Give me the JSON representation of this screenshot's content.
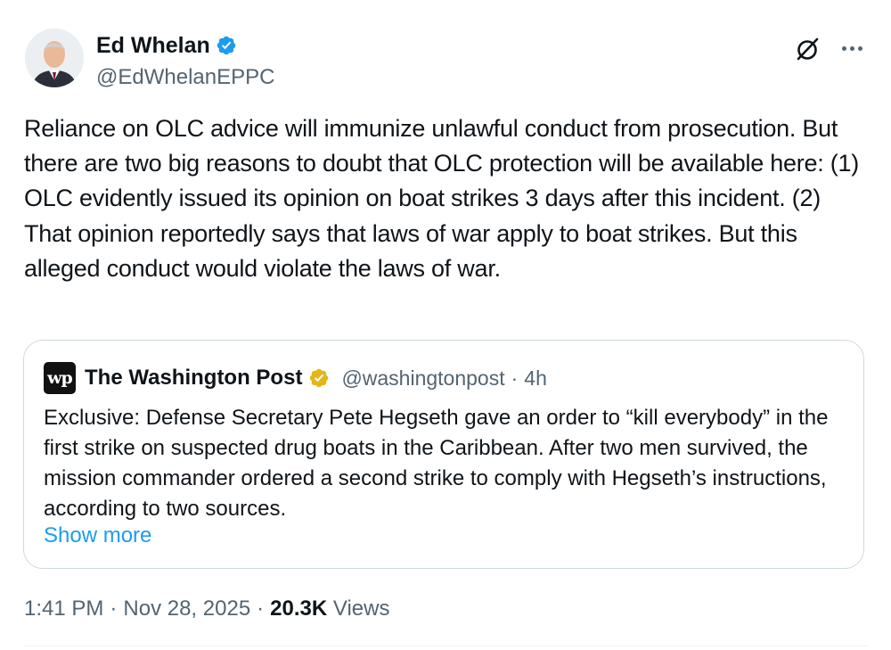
{
  "author": {
    "display_name": "Ed Whelan",
    "handle": "@EdWhelanEPPC",
    "verified_color": "#1d9bf0"
  },
  "tweet": {
    "text": "Reliance on OLC advice will immunize unlawful conduct from prosecution. But there are two big reasons to doubt that OLC protection will be available here: (1) OLC evidently issued its opinion on boat strikes 3 days after this incident. (2) That opinion reportedly says that laws of war apply to boat strikes. But this alleged conduct would violate the laws of war."
  },
  "quote": {
    "logo_text": "wp",
    "display_name": "The Washington Post",
    "handle": "@washingtonpost",
    "separator": "·",
    "time": "4h",
    "verified_color": "#e2b719",
    "text": "Exclusive: Defense Secretary Pete Hegseth gave an order to “kill everybody” in the first strike on suspected drug boats in the Caribbean. After two men survived, the mission commander ordered a second strike to comply with Hegseth’s instructions, according to two sources.",
    "show_more": "Show more"
  },
  "meta": {
    "time": "1:41 PM",
    "dot1": "·",
    "date": "Nov 28, 2025",
    "dot2": "·",
    "views_count": "20.3K",
    "views_label": "Views"
  },
  "icons": {
    "grok": "grok-icon",
    "more": "more-icon",
    "verified": "verified-badge-icon",
    "gold_verified": "gold-verified-badge-icon"
  },
  "colors": {
    "link": "#1d9bf0",
    "secondary_text": "#536471",
    "border": "#cfd9de"
  }
}
